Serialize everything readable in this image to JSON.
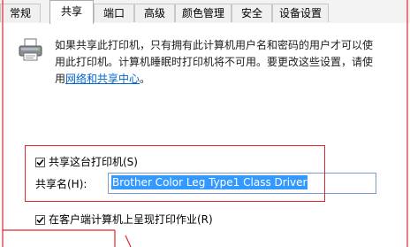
{
  "tabs": [
    {
      "label": "常规",
      "active": false
    },
    {
      "label": "共享",
      "active": true
    },
    {
      "label": "端口",
      "active": false
    },
    {
      "label": "高级",
      "active": false
    },
    {
      "label": "颜色管理",
      "active": false
    },
    {
      "label": "安全",
      "active": false
    },
    {
      "label": "设备设置",
      "active": false
    }
  ],
  "info": {
    "line1": "如果共享此打印机，只有拥有此计算机用户名和密码的用户才可以使",
    "line2": "用此打印机。计算机睡眠时打印机将不可用。要更改这些设置，请使",
    "line3_prefix": "用",
    "link": "网络和共享中心",
    "line3_suffix": "。"
  },
  "share_checkbox": {
    "label": "共享这台打印机(S)",
    "checked": true
  },
  "share_name": {
    "label": "共享名(H):",
    "value": "Brother Color Leg Type1 Class Driver"
  },
  "render_checkbox": {
    "label": "在客户端计算机上呈现打印作业(R)",
    "checked": true
  },
  "colors": {
    "accent": "#3399ff",
    "link": "#0066cc",
    "annotation": "#e0272b"
  }
}
